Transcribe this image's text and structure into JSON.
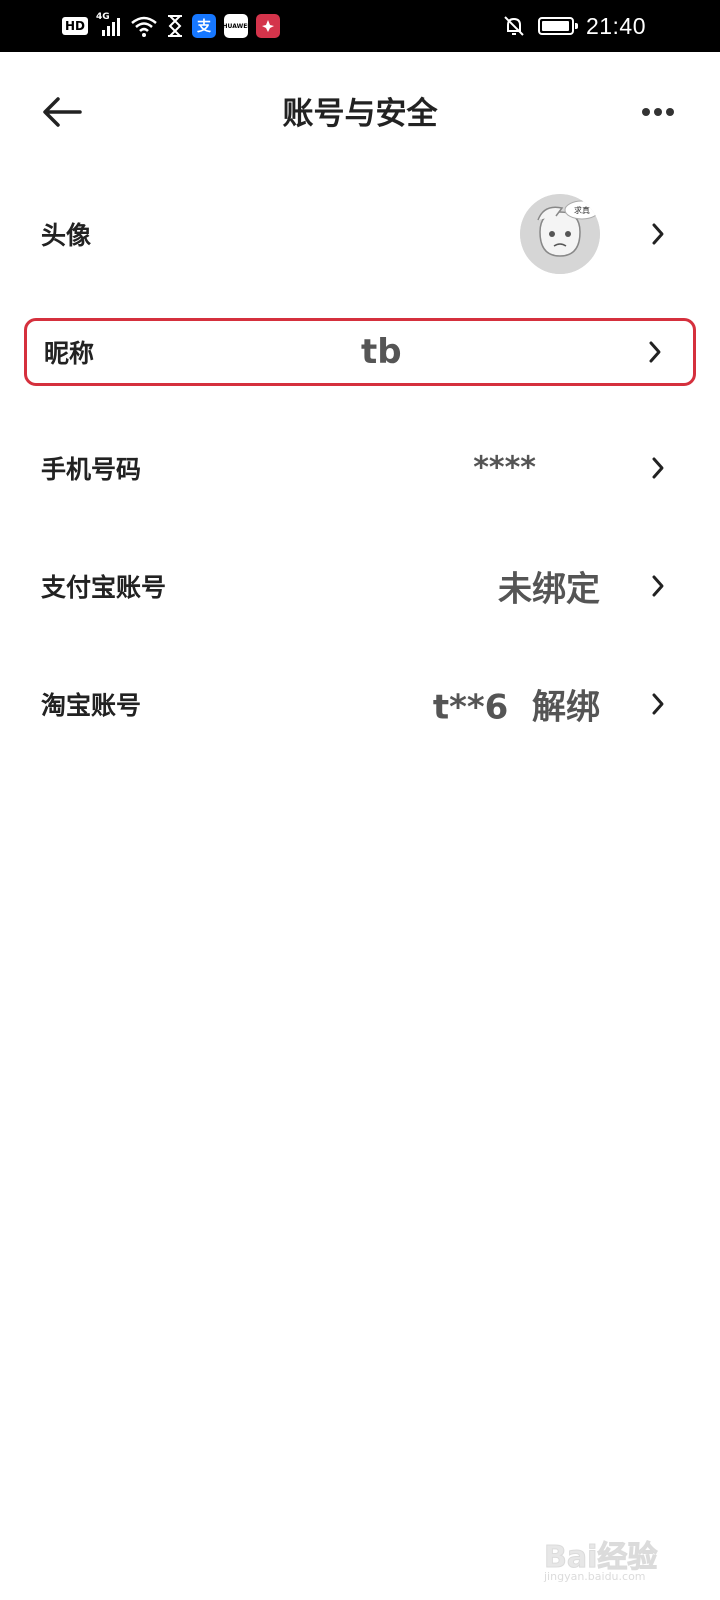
{
  "status_bar": {
    "hd": "HD",
    "network": "4G",
    "signal_level": 4,
    "alipay_glyph": "支",
    "huawei_label": "HUAWEI",
    "time": "21:40",
    "battery_level": 0.95,
    "icons": [
      "hd-icon",
      "signal-icon",
      "wifi-icon",
      "hourglass-icon",
      "alipay-app-icon",
      "huawei-app-icon",
      "red-app-icon",
      "notifications-off-icon",
      "battery-icon"
    ]
  },
  "header": {
    "title": "账号与安全",
    "back_icon": "back-arrow-icon",
    "more_icon": "more-icon"
  },
  "rows": [
    {
      "label": "头像",
      "value": "",
      "has_avatar": true
    },
    {
      "label": "昵称",
      "value": "tb",
      "highlighted": true
    },
    {
      "label": "手机号码",
      "value": "****"
    },
    {
      "label": "支付宝账号",
      "value": "未绑定"
    },
    {
      "label": "淘宝账号",
      "value": "t**6  解绑"
    }
  ],
  "avatar": {
    "caption": "求真"
  },
  "watermark": {
    "text": "Bai经验",
    "sub": "jingyan.baidu.com"
  },
  "colors": {
    "highlight_border": "#d5303d",
    "status_bar_bg": "#000000",
    "value_text": "#555555"
  }
}
